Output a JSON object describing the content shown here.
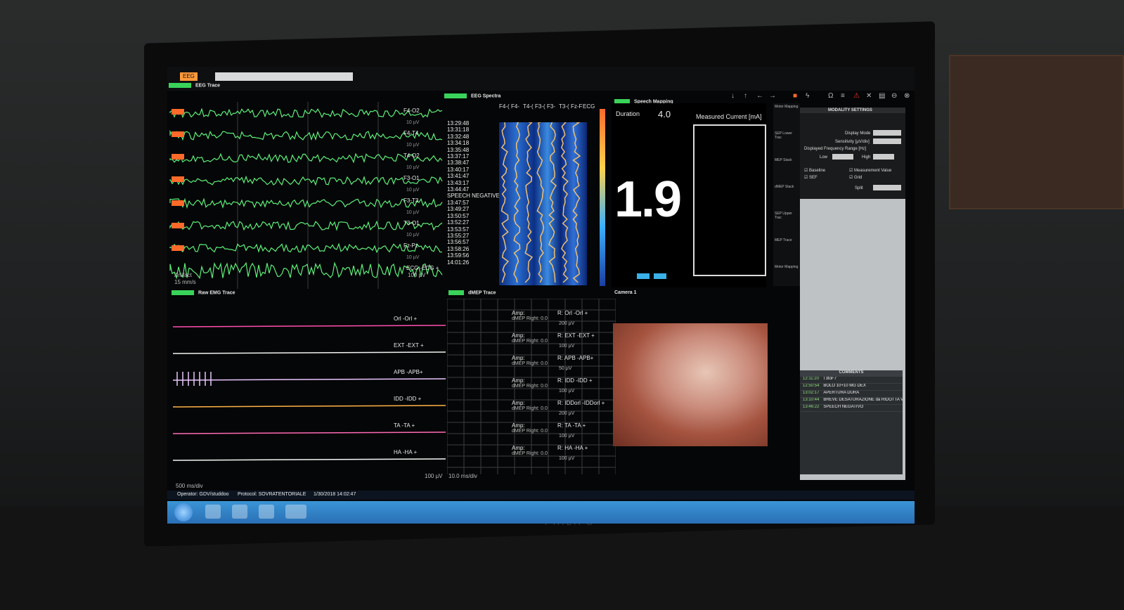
{
  "monitor": {
    "brand": "PHILIPS"
  },
  "top_tabs": {
    "active": "EEG"
  },
  "eeg_trace": {
    "title": "EEG Trace",
    "channels": [
      "F4-O2",
      "F4-T4",
      "T4-O2",
      "F3-O1",
      "F3-T3",
      "T3-O1",
      "Fz-Pz",
      "ECG -ECG +"
    ],
    "scale_label": "10 µV",
    "ecg_scale": "100 µV",
    "artifact_label": "Artifact",
    "speed_label": "15 mm/s",
    "timestamps": [
      "13:29:48",
      "13:31:18",
      "13:32:48",
      "13:34:18",
      "13:35:48",
      "13:37:17",
      "13:38:47",
      "13:40:17",
      "13:41:47",
      "13:43:17",
      "13:44:47",
      "SPEECH NEGATIVE",
      "13:47:57",
      "13:49:27",
      "13:50:57",
      "13:52:27",
      "13:53:57",
      "13:55:27",
      "13:56:57",
      "13:58:26",
      "13:59:56",
      "14:01:26"
    ]
  },
  "eeg_spectra": {
    "title": "EEG Spectra",
    "headers": [
      "F4-(",
      "F4-",
      "T4-(",
      "F3-(",
      "F3-",
      "T3-(",
      "Fz-F",
      "ECG"
    ]
  },
  "speech_mapping": {
    "title": "Speech Mapping",
    "duration_label": "Duration",
    "duration_value": "4.0",
    "current_value": "1.9",
    "measured_current_label": "Measured Current [mA]"
  },
  "side_modules": [
    "Motor Mapping",
    "SEP Lower Trac",
    "MEP Stack",
    "dMEP Stack",
    "SEP Upper Trac",
    "MEP Trace",
    "Motor Mapping"
  ],
  "modality_settings": {
    "title": "MODALITY SETTINGS",
    "display_mode_label": "Display Mode",
    "sensitivity_label": "Sensitivity [µV/div]",
    "freq_range_label": "Displayed Frequency Range [Hz]",
    "low_label": "Low",
    "high_label": "High",
    "baseline_label": "Baseline",
    "sef_label": "SEF",
    "measurement_label": "Measurement Value",
    "grid_label": "Grid",
    "split_label": "Split"
  },
  "comments": {
    "title": "COMMENTS",
    "entries": [
      {
        "time": "12:11:20",
        "text": "T3toF7"
      },
      {
        "time": "12:50:54",
        "text": "BOLO 10+10 MG DEX"
      },
      {
        "time": "13:02:17",
        "text": "APERTURA DURA"
      },
      {
        "time": "13:10:44",
        "text": "BREVE DESATURAZIONE da RIDOTTA VENTILAZIONE"
      },
      {
        "time": "13:46:22",
        "text": "SPEECH NEGATIVO"
      }
    ]
  },
  "raw_emg": {
    "title": "Raw EMG Trace",
    "channels": [
      "Orl -Orl +",
      "EXT -EXT +",
      "APB -APB+",
      "IDD -IDD +",
      "TA -TA +",
      "HA -HA +"
    ],
    "scale_label": "100 µV",
    "speed_label": "500 ms/div"
  },
  "dmep": {
    "title": "dMEP Trace",
    "amp_label": "Amp:",
    "right_label": "dMEP Right: 0.0",
    "channels": [
      "R: Orl -Orl +",
      "R: EXT -EXT +",
      "R: APB -APB+",
      "R: IDD -IDD +",
      "R: IDDorl -IDDorl +",
      "R: TA -TA +",
      "R: HA -HA +"
    ],
    "scales": [
      "200 µV",
      "100 µV",
      "50 µV",
      "100 µV",
      "200 µV",
      "100 µV",
      "100 µV"
    ],
    "speed_label": "10.0 ms/div"
  },
  "camera": {
    "title": "Camera 1"
  },
  "statusbar": {
    "operator": "Operator: GDV/studdoo",
    "protocol": "Protocol: SOVRATENTORIALE",
    "datetime": "1/30/2018 14:02:47"
  }
}
